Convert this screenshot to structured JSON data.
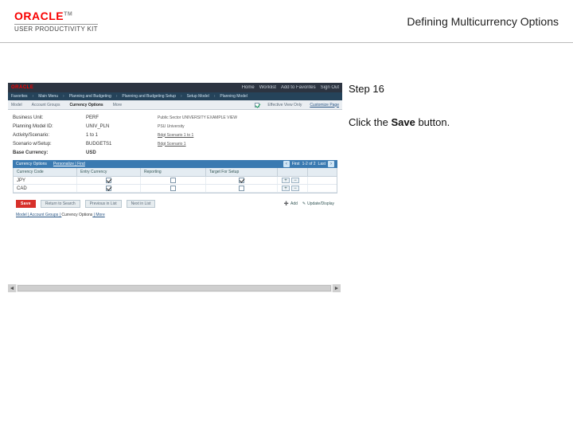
{
  "header": {
    "brand": "ORACLE",
    "tm": "TM",
    "upk": "USER PRODUCTIVITY KIT",
    "title": "Defining Multicurrency Options"
  },
  "instruction": {
    "step_label": "Step 16",
    "prefix": "Click the ",
    "bold": "Save",
    "suffix": " button."
  },
  "app": {
    "brand": "ORACLE",
    "top_right": [
      "Home",
      "Worklist",
      "Add to Favorites",
      "Sign Out"
    ],
    "breadcrumb": [
      "Favorites",
      "Main Menu",
      "Planning and Budgeting",
      "Planning and Budgeting Setup",
      "Setup Model",
      "Planning Model"
    ],
    "toolbar": {
      "items": [
        "Model",
        "Account Groups",
        "Currency Options",
        "More"
      ],
      "right_check_label": "Effective View Only",
      "customize": "Customize Page"
    },
    "fields": {
      "bu": {
        "label": "Business Unit:",
        "v1": "PERF",
        "v2": "Public Sector UNIVERSITY EXAMPLE VIEW"
      },
      "pm": {
        "label": "Planning Model ID:",
        "v1": "UNIV_PLN",
        "v2": "PSU University"
      },
      "as": {
        "label": "Activity/Scenario:",
        "v1": "1 to 1",
        "v2": "Bdgt Scenario 1 to 1"
      },
      "sc": {
        "label": "Scenario w/Setup:",
        "v1": "BUDGETS1",
        "v2": "Bdgt Scenario 1"
      },
      "base": {
        "label": "Base Currency:",
        "v1": "USD"
      }
    },
    "section": {
      "title": "Currency Options",
      "pager_label": "First",
      "pager_center": "1-2 of 2",
      "pager_right": "Last"
    },
    "grid": {
      "cols": [
        "Currency Code",
        "Entry Currency",
        "Reporting",
        "Target For Setup",
        ""
      ],
      "rows": [
        {
          "code": "JPY",
          "entry": true,
          "reporting": false,
          "target": true
        },
        {
          "code": "CAD",
          "entry": true,
          "reporting": false,
          "target": false
        }
      ],
      "row_btns": [
        "+",
        "−"
      ]
    },
    "footer": {
      "save": "Save",
      "return": "Return to Search",
      "prev": "Previous in List",
      "next": "Next in List",
      "add": "Add",
      "upd": "Update/Display",
      "line2_prefix": "Model | Account Groups | ",
      "line2_curr": "Currency Options",
      "line2_suffix": " | More"
    }
  }
}
